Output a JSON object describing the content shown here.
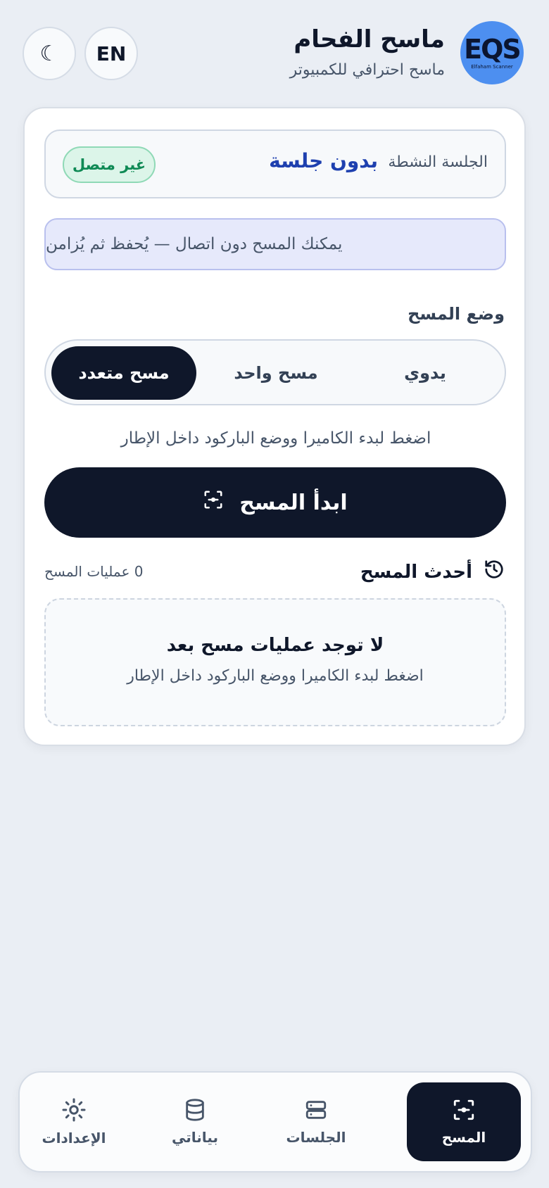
{
  "header": {
    "logo_text": "EQS",
    "logo_subtext": "Elfaham Scanner",
    "title": "ماسح الفحام",
    "subtitle": "ماسح احترافي للكمبيوتر",
    "lang_button": "EN",
    "theme_icon": "moon-icon"
  },
  "session": {
    "label": "الجلسة النشطة",
    "value": "بدون جلسة",
    "status": "غير متصل",
    "status_color": "#0f8a55"
  },
  "offline_note": "يمكنك المسح دون اتصال — يُحفظ ثم يُزامن",
  "scan_mode": {
    "label": "وضع المسح",
    "options": [
      "يدوي",
      "مسح واحد",
      "مسح متعدد"
    ],
    "selected": "مسح متعدد"
  },
  "hint": "اضغط لبدء الكاميرا ووضع الباركود داخل الإطار",
  "start_button": {
    "label": "ابدأ المسح",
    "icon": "scan-icon"
  },
  "recent": {
    "title": "أحدث المسح",
    "icon": "history-icon",
    "count": "0 عمليات المسح",
    "empty_title": "لا توجد عمليات مسح بعد",
    "empty_text": "اضغط لبدء الكاميرا ووضع الباركود داخل الإطار"
  },
  "nav": {
    "items": [
      {
        "label": "المسح",
        "icon": "scan-icon",
        "active": true
      },
      {
        "label": "الجلسات",
        "icon": "server-icon",
        "active": false
      },
      {
        "label": "بياناتي",
        "icon": "database-icon",
        "active": false
      },
      {
        "label": "الإعدادات",
        "icon": "sun-icon",
        "active": false
      }
    ]
  },
  "colors": {
    "accent_dark": "#0f172a",
    "session_blue": "#1e40af",
    "background": "#eaeef4"
  }
}
